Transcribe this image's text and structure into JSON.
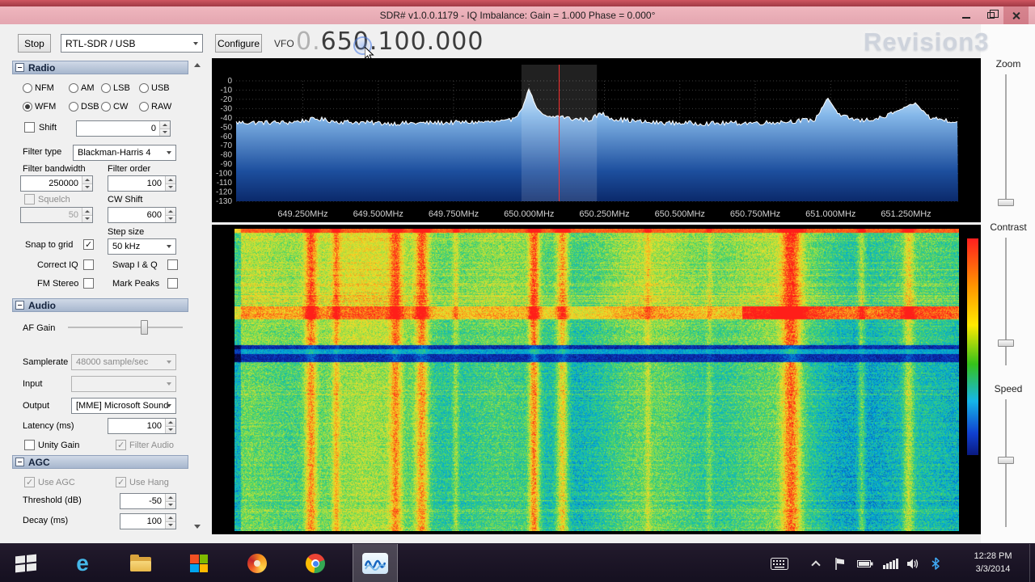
{
  "window": {
    "title": "SDR# v1.0.0.1179 - IQ Imbalance: Gain = 1.000 Phase = 0.000°"
  },
  "toolbar": {
    "stop_label": "Stop",
    "device_value": "RTL-SDR / USB",
    "configure_label": "Configure",
    "vfo_label": "VFO",
    "frequency_leading": "0.",
    "frequency_main": "650.100.000"
  },
  "watermark": "Revision3",
  "sidebar": {
    "radio": {
      "header": "Radio",
      "modes": [
        "NFM",
        "AM",
        "LSB",
        "USB",
        "WFM",
        "DSB",
        "CW",
        "RAW"
      ],
      "selected_mode": "WFM",
      "shift_label": "Shift",
      "shift_value": "0",
      "filter_type_label": "Filter type",
      "filter_type_value": "Blackman-Harris 4",
      "filter_bandwidth_label": "Filter bandwidth",
      "filter_bandwidth_value": "250000",
      "filter_order_label": "Filter order",
      "filter_order_value": "100",
      "squelch_label": "Squelch",
      "squelch_value": "50",
      "cw_shift_label": "CW Shift",
      "cw_shift_value": "600",
      "snap_to_grid_label": "Snap to grid",
      "step_size_label": "Step size",
      "step_size_value": "50 kHz",
      "correct_iq_label": "Correct IQ",
      "swap_iq_label": "Swap I & Q",
      "fm_stereo_label": "FM Stereo",
      "mark_peaks_label": "Mark Peaks"
    },
    "audio": {
      "header": "Audio",
      "af_gain_label": "AF Gain",
      "af_gain_percent": 68,
      "samplerate_label": "Samplerate",
      "samplerate_value": "48000 sample/sec",
      "input_label": "Input",
      "input_value": "",
      "output_label": "Output",
      "output_value": "[MME] Microsoft Sound",
      "latency_label": "Latency (ms)",
      "latency_value": "100",
      "unity_gain_label": "Unity Gain",
      "filter_audio_label": "Filter Audio"
    },
    "agc": {
      "header": "AGC",
      "use_agc_label": "Use AGC",
      "use_hang_label": "Use Hang",
      "threshold_label": "Threshold (dB)",
      "threshold_value": "-50",
      "decay_label": "Decay (ms)",
      "decay_value": "100"
    }
  },
  "spectrum": {
    "db_labels": [
      "0",
      "-10",
      "-20",
      "-30",
      "-40",
      "-50",
      "-60",
      "-70",
      "-80",
      "-90",
      "-100",
      "-110",
      "-120",
      "-130"
    ],
    "freq_labels": [
      "649.250MHz",
      "649.500MHz",
      "649.750MHz",
      "650.000MHz",
      "650.250MHz",
      "650.500MHz",
      "650.750MHz",
      "651.000MHz",
      "651.250MHz"
    ],
    "tuned_mhz": 650.1,
    "filter_bw_mhz": 0.25,
    "noise_floor_db": -46,
    "points": [
      [
        649.03,
        -45
      ],
      [
        649.2,
        -45
      ],
      [
        649.3,
        -41
      ],
      [
        649.36,
        -44
      ],
      [
        649.55,
        -46
      ],
      [
        649.75,
        -45
      ],
      [
        649.93,
        -44
      ],
      [
        649.975,
        -32
      ],
      [
        650.0,
        -8
      ],
      [
        650.025,
        -30
      ],
      [
        650.06,
        -40
      ],
      [
        650.1,
        -38
      ],
      [
        650.14,
        -41
      ],
      [
        650.2,
        -42
      ],
      [
        650.24,
        -35
      ],
      [
        650.28,
        -41
      ],
      [
        650.4,
        -45
      ],
      [
        650.6,
        -46
      ],
      [
        650.8,
        -45
      ],
      [
        650.95,
        -42
      ],
      [
        650.99,
        -18
      ],
      [
        651.03,
        -38
      ],
      [
        651.1,
        -43
      ],
      [
        651.17,
        -40
      ],
      [
        651.28,
        -24
      ],
      [
        651.33,
        -40
      ],
      [
        651.42,
        -44
      ]
    ]
  },
  "waterfall": {
    "streaks": [
      {
        "p": 0.105,
        "w": 0.008,
        "s": 0.42
      },
      {
        "p": 0.14,
        "w": 0.005,
        "s": 0.28
      },
      {
        "p": 0.222,
        "w": 0.008,
        "s": 0.38
      },
      {
        "p": 0.258,
        "w": 0.009,
        "s": 0.45
      },
      {
        "p": 0.305,
        "w": 0.004,
        "s": 0.18
      },
      {
        "p": 0.413,
        "w": 0.007,
        "s": 0.52
      },
      {
        "p": 0.452,
        "w": 0.008,
        "s": 0.42
      },
      {
        "p": 0.57,
        "w": 0.004,
        "s": 0.15
      },
      {
        "p": 0.655,
        "w": 0.004,
        "s": 0.12
      },
      {
        "p": 0.768,
        "w": 0.013,
        "s": 0.5
      },
      {
        "p": 0.865,
        "w": 0.005,
        "s": 0.22
      },
      {
        "p": 0.93,
        "w": 0.007,
        "s": 0.28
      }
    ],
    "warm_band": {
      "from_frac": 0.255,
      "to_frac": 0.298
    },
    "blue_band": {
      "from_frac": 0.385,
      "to_frac": 0.44
    }
  },
  "right_panel": {
    "zoom_label": "Zoom",
    "contrast_label": "Contrast",
    "speed_label": "Speed"
  },
  "taskbar": {
    "clock_time": "12:28 PM",
    "clock_date": "3/3/2014"
  }
}
